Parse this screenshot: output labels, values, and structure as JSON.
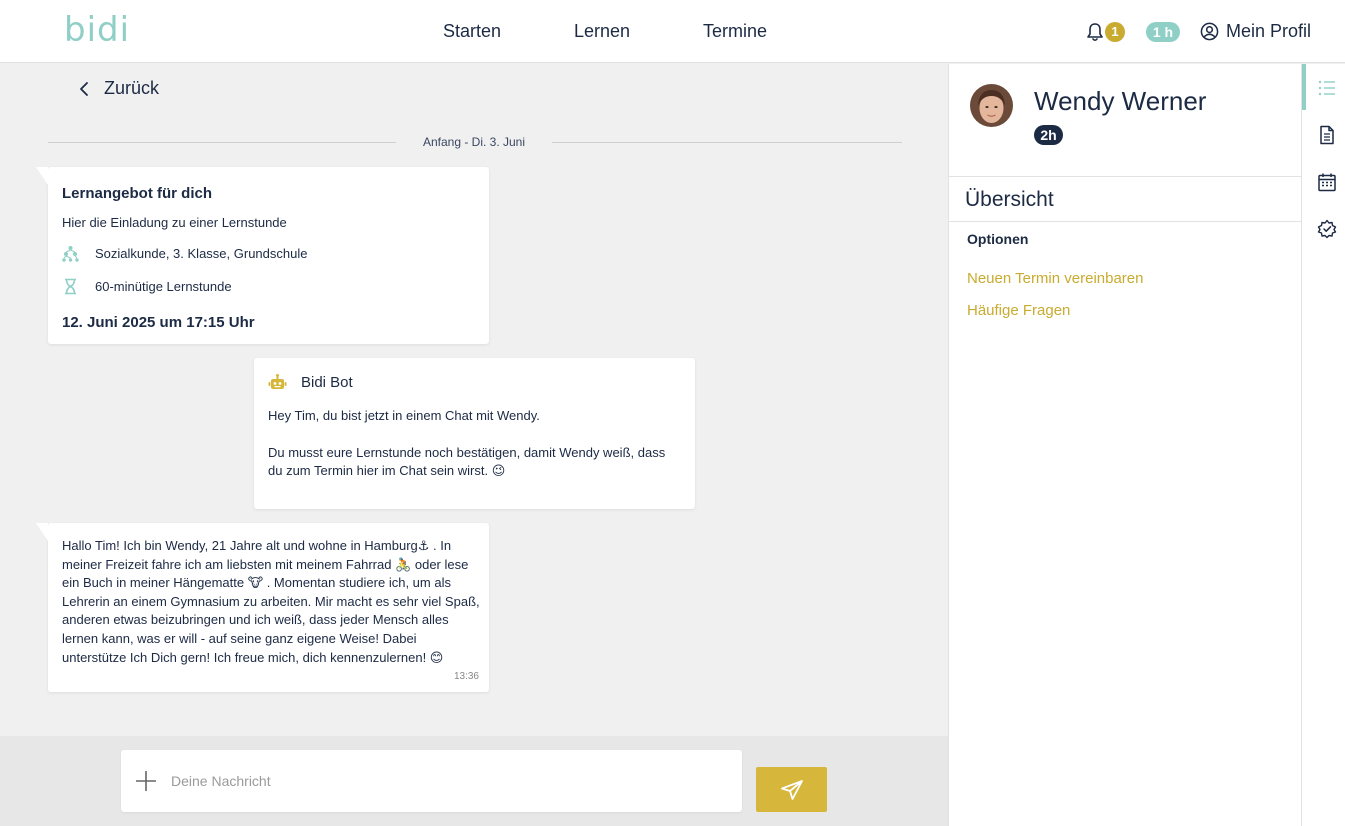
{
  "header": {
    "logo": "bidi",
    "nav": [
      "Starten",
      "Lernen",
      "Termine"
    ],
    "notification_count": "1",
    "hours_badge": "1 h",
    "profile_label": "Mein Profil"
  },
  "chat": {
    "back_label": "Zurück",
    "date_divider": "Anfang - Di. 3. Juni",
    "offer": {
      "title": "Lernangebot für dich",
      "subtitle": "Hier die Einladung zu einer Lernstunde",
      "subject": "Sozialkunde, 3. Klasse, Grundschule",
      "duration": "60-minütige Lernstunde",
      "date": "12. Juni 2025 um 17:15 Uhr"
    },
    "bot": {
      "name": "Bidi Bot",
      "line1": "Hey Tim, du bist jetzt in einem Chat mit Wendy.",
      "line2": "Du musst eure Lernstunde noch bestätigen, damit Wendy weiß, dass du zum Termin hier im Chat sein wirst. 😉"
    },
    "message": {
      "text": "Hallo Tim! Ich bin Wendy, 21 Jahre alt und wohne in Hamburg⚓ . In meiner Freizeit fahre ich am liebsten mit meinem Fahrrad 🚴 oder lese ein Buch in meiner Hängematte 🐮 . Momentan studiere ich, um als Lehrerin an einem Gymnasium zu arbeiten. Mir macht es sehr viel Spaß, anderen etwas beizubringen und ich weiß, dass jeder Mensch alles lernen kann, was er will - auf seine ganz eigene Weise! Dabei unterstütze Ich Dich gern! Ich freue mich, dich kennenzulernen! 😊",
      "time": "13:36"
    }
  },
  "composer": {
    "placeholder": "Deine Nachricht",
    "value": ""
  },
  "panel": {
    "name": "Wendy Werner",
    "hours": "2h",
    "overview_title": "Übersicht",
    "options_label": "Optionen",
    "options": [
      "Neuen Termin vereinbaren",
      "Häufige Fragen"
    ]
  },
  "rail": {
    "icons": [
      "list-icon",
      "document-icon",
      "calendar-icon",
      "settings-icon"
    ]
  },
  "colors": {
    "navy": "#1c2a44",
    "teal": "#8fcfc6",
    "gold": "#c9ab2f",
    "send_button": "#d6b73c"
  }
}
